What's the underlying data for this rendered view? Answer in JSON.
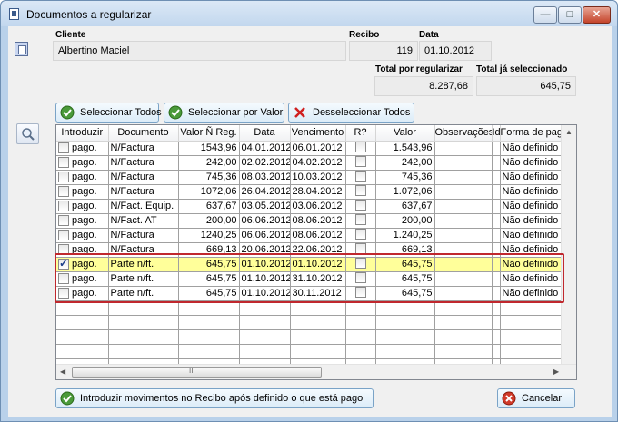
{
  "window": {
    "title": "Documentos a regularizar"
  },
  "labels": {
    "cliente": "Cliente",
    "recibo": "Recibo",
    "data": "Data",
    "total_regularizar": "Total por regularizar",
    "total_selecionado": "Total já seleccionado"
  },
  "fields": {
    "cliente": "Albertino Maciel",
    "recibo": "119",
    "data": "01.10.2012",
    "total_regularizar": "8.287,68",
    "total_selecionado": "645,75"
  },
  "buttons": {
    "selecionar_todos": "Seleccionar Todos",
    "selecionar_valor": "Seleccionar por Valor",
    "desselecionar_todos": "Desseleccionar Todos",
    "introduzir": "Introduzir movimentos no Recibo após definido o que está pago",
    "cancelar": "Cancelar"
  },
  "table": {
    "headers": [
      "Introduzir",
      "Documento",
      "Valor Ñ Reg.",
      "Data",
      "Vencimento",
      "R?",
      "Valor",
      "Observações",
      "Id",
      "Forma de pagamento"
    ],
    "rows": [
      {
        "intro": "pago.",
        "checked": false,
        "doc": "N/Factura",
        "vnreg": "1543,96",
        "data": "04.01.2012",
        "venc": "06.01.2012",
        "valor": "1.543,96",
        "forma": "Não definido"
      },
      {
        "intro": "pago.",
        "checked": false,
        "doc": "N/Factura",
        "vnreg": "242,00",
        "data": "02.02.2012",
        "venc": "04.02.2012",
        "valor": "242,00",
        "forma": "Não definido"
      },
      {
        "intro": "pago.",
        "checked": false,
        "doc": "N/Factura",
        "vnreg": "745,36",
        "data": "08.03.2012",
        "venc": "10.03.2012",
        "valor": "745,36",
        "forma": "Não definido"
      },
      {
        "intro": "pago.",
        "checked": false,
        "doc": "N/Factura",
        "vnreg": "1072,06",
        "data": "26.04.2012",
        "venc": "28.04.2012",
        "valor": "1.072,06",
        "forma": "Não definido"
      },
      {
        "intro": "pago.",
        "checked": false,
        "doc": "N/Fact. Equip.",
        "vnreg": "637,67",
        "data": "03.05.2012",
        "venc": "03.06.2012",
        "valor": "637,67",
        "forma": "Não definido"
      },
      {
        "intro": "pago.",
        "checked": false,
        "doc": "N/Fact. AT",
        "vnreg": "200,00",
        "data": "06.06.2012",
        "venc": "08.06.2012",
        "valor": "200,00",
        "forma": "Não definido"
      },
      {
        "intro": "pago.",
        "checked": false,
        "doc": "N/Factura",
        "vnreg": "1240,25",
        "data": "06.06.2012",
        "venc": "08.06.2012",
        "valor": "1.240,25",
        "forma": "Não definido"
      },
      {
        "intro": "pago.",
        "checked": false,
        "doc": "N/Factura",
        "vnreg": "669,13",
        "data": "20.06.2012",
        "venc": "22.06.2012",
        "valor": "669,13",
        "forma": "Não definido"
      },
      {
        "intro": "pago.",
        "checked": true,
        "doc": "Parte n/ft.",
        "vnreg": "645,75",
        "data": "01.10.2012",
        "venc": "01.10.2012",
        "valor": "645,75",
        "forma": "Não definido"
      },
      {
        "intro": "pago.",
        "checked": false,
        "doc": "Parte n/ft.",
        "vnreg": "645,75",
        "data": "01.10.2012",
        "venc": "31.10.2012",
        "valor": "645,75",
        "forma": "Não definido"
      },
      {
        "intro": "pago.",
        "checked": false,
        "doc": "Parte n/ft.",
        "vnreg": "645,75",
        "data": "01.10.2012",
        "venc": "30.11.2012",
        "valor": "645,75",
        "forma": "Não definido"
      }
    ],
    "empty_rows": 5,
    "selected_row": 8
  },
  "scrollbar": {
    "grip": "III"
  },
  "colors": {
    "selected_row": "#ffff9a",
    "highlight_box": "#c0282e"
  }
}
